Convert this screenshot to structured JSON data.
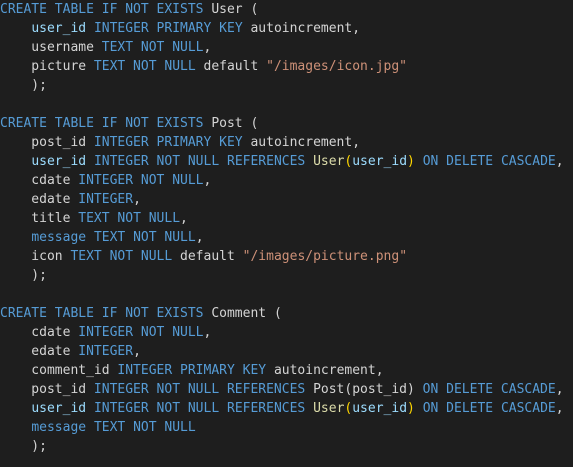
{
  "colors": {
    "background": "#1e1e1e",
    "keyword": "#569cd6",
    "plain": "#d4d4d4",
    "identifier": "#9cdcfe",
    "function": "#dcdcaa",
    "string": "#ce9178",
    "paren": "#ffd700"
  },
  "lines": [
    [
      [
        "kw",
        "CREATE TABLE IF NOT EXISTS"
      ],
      [
        "plain",
        " User ("
      ]
    ],
    [
      [
        "plain",
        "    "
      ],
      [
        "ident",
        "user_id"
      ],
      [
        "plain",
        " "
      ],
      [
        "kw",
        "INTEGER PRIMARY KEY"
      ],
      [
        "plain",
        " autoincrement,"
      ]
    ],
    [
      [
        "plain",
        "    username "
      ],
      [
        "kw",
        "TEXT NOT NULL"
      ],
      [
        "plain",
        ","
      ]
    ],
    [
      [
        "plain",
        "    picture "
      ],
      [
        "kw",
        "TEXT NOT NULL"
      ],
      [
        "plain",
        " default "
      ],
      [
        "str",
        "\"/images/icon.jpg\""
      ]
    ],
    [
      [
        "plain",
        "    );"
      ]
    ],
    [
      [
        "plain",
        ""
      ]
    ],
    [
      [
        "kw",
        "CREATE TABLE IF NOT EXISTS"
      ],
      [
        "plain",
        " Post ("
      ]
    ],
    [
      [
        "plain",
        "    post_id "
      ],
      [
        "kw",
        "INTEGER PRIMARY KEY"
      ],
      [
        "plain",
        " autoincrement,"
      ]
    ],
    [
      [
        "plain",
        "    "
      ],
      [
        "ident",
        "user_id"
      ],
      [
        "plain",
        " "
      ],
      [
        "kw",
        "INTEGER NOT NULL REFERENCES"
      ],
      [
        "plain",
        " "
      ],
      [
        "func",
        "User"
      ],
      [
        "paren",
        "("
      ],
      [
        "ident",
        "user_id"
      ],
      [
        "paren",
        ")"
      ],
      [
        "plain",
        " "
      ],
      [
        "kw",
        "ON DELETE CASCADE"
      ],
      [
        "plain",
        ","
      ]
    ],
    [
      [
        "plain",
        "    cdate "
      ],
      [
        "kw",
        "INTEGER NOT NULL"
      ],
      [
        "plain",
        ","
      ]
    ],
    [
      [
        "plain",
        "    edate "
      ],
      [
        "kw",
        "INTEGER"
      ],
      [
        "plain",
        ","
      ]
    ],
    [
      [
        "plain",
        "    title "
      ],
      [
        "kw",
        "TEXT NOT NULL"
      ],
      [
        "plain",
        ","
      ]
    ],
    [
      [
        "plain",
        "    "
      ],
      [
        "kw",
        "message"
      ],
      [
        "plain",
        " "
      ],
      [
        "kw",
        "TEXT NOT NULL"
      ],
      [
        "plain",
        ","
      ]
    ],
    [
      [
        "plain",
        "    icon "
      ],
      [
        "kw",
        "TEXT NOT NULL"
      ],
      [
        "plain",
        " default "
      ],
      [
        "str",
        "\"/images/picture.png\""
      ]
    ],
    [
      [
        "plain",
        "    );"
      ]
    ],
    [
      [
        "plain",
        ""
      ]
    ],
    [
      [
        "kw",
        "CREATE TABLE IF NOT EXISTS"
      ],
      [
        "plain",
        " Comment ("
      ]
    ],
    [
      [
        "plain",
        "    cdate "
      ],
      [
        "kw",
        "INTEGER NOT NULL"
      ],
      [
        "plain",
        ","
      ]
    ],
    [
      [
        "plain",
        "    edate "
      ],
      [
        "kw",
        "INTEGER"
      ],
      [
        "plain",
        ","
      ]
    ],
    [
      [
        "plain",
        "    comment_id "
      ],
      [
        "kw",
        "INTEGER PRIMARY KEY"
      ],
      [
        "plain",
        " autoincrement,"
      ]
    ],
    [
      [
        "plain",
        "    post_id "
      ],
      [
        "kw",
        "INTEGER NOT NULL REFERENCES"
      ],
      [
        "plain",
        " Post(post_id) "
      ],
      [
        "kw",
        "ON DELETE CASCADE"
      ],
      [
        "plain",
        ","
      ]
    ],
    [
      [
        "plain",
        "    "
      ],
      [
        "ident",
        "user_id"
      ],
      [
        "plain",
        " "
      ],
      [
        "kw",
        "INTEGER NOT NULL REFERENCES"
      ],
      [
        "plain",
        " "
      ],
      [
        "func",
        "User"
      ],
      [
        "paren",
        "("
      ],
      [
        "ident",
        "user_id"
      ],
      [
        "paren",
        ")"
      ],
      [
        "plain",
        " "
      ],
      [
        "kw",
        "ON DELETE CASCADE"
      ],
      [
        "plain",
        ","
      ]
    ],
    [
      [
        "plain",
        "    "
      ],
      [
        "kw",
        "message"
      ],
      [
        "plain",
        " "
      ],
      [
        "kw",
        "TEXT NOT NULL"
      ]
    ],
    [
      [
        "plain",
        "    );"
      ]
    ]
  ]
}
